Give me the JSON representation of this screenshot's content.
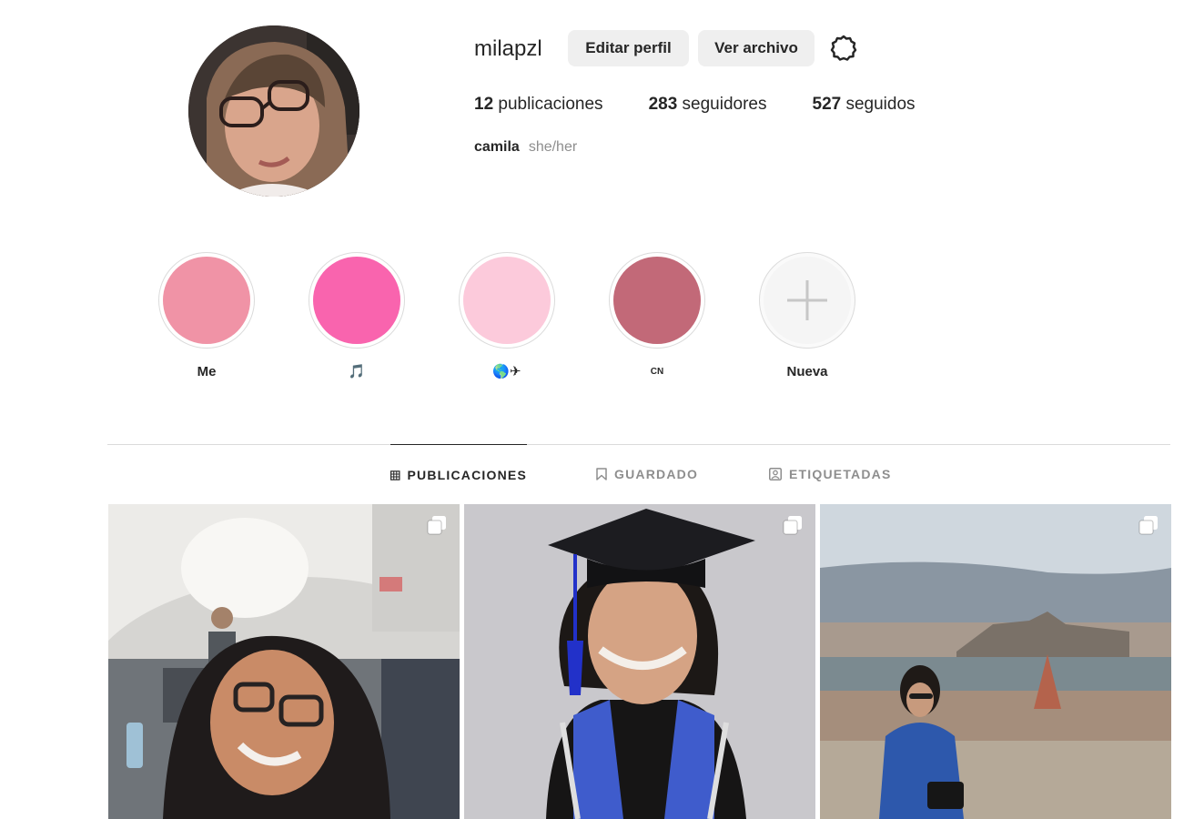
{
  "profile": {
    "username": "milapzl",
    "edit_label": "Editar perfil",
    "archive_label": "Ver archivo",
    "posts_count": "12",
    "posts_label": "publicaciones",
    "followers_count": "283",
    "followers_label": "seguidores",
    "following_count": "527",
    "following_label": "seguidos",
    "name": "camila",
    "pronouns": "she/her"
  },
  "highlights": [
    {
      "label": "Me",
      "color": "#f093a6"
    },
    {
      "label": "🎵",
      "color": "#f964ae"
    },
    {
      "label": "🌎✈",
      "color": "#fccadb"
    },
    {
      "label": "CN",
      "color": "#c26978"
    },
    {
      "label": "Nueva"
    }
  ],
  "tabs": [
    {
      "label": "PUBLICACIONES",
      "icon": "grid-icon",
      "active": true
    },
    {
      "label": "GUARDADO",
      "icon": "bookmark-icon"
    },
    {
      "label": "ETIQUETADAS",
      "icon": "tagged-icon"
    }
  ],
  "posts": [
    {
      "icon": "multiple-photos-icon"
    },
    {
      "icon": "multiple-photos-icon"
    },
    {
      "icon": "multiple-photos-icon"
    }
  ],
  "colors": {
    "button_bg": "#efefef",
    "border": "#dbdbdb",
    "muted": "#8e8e8e",
    "text": "#262626"
  }
}
